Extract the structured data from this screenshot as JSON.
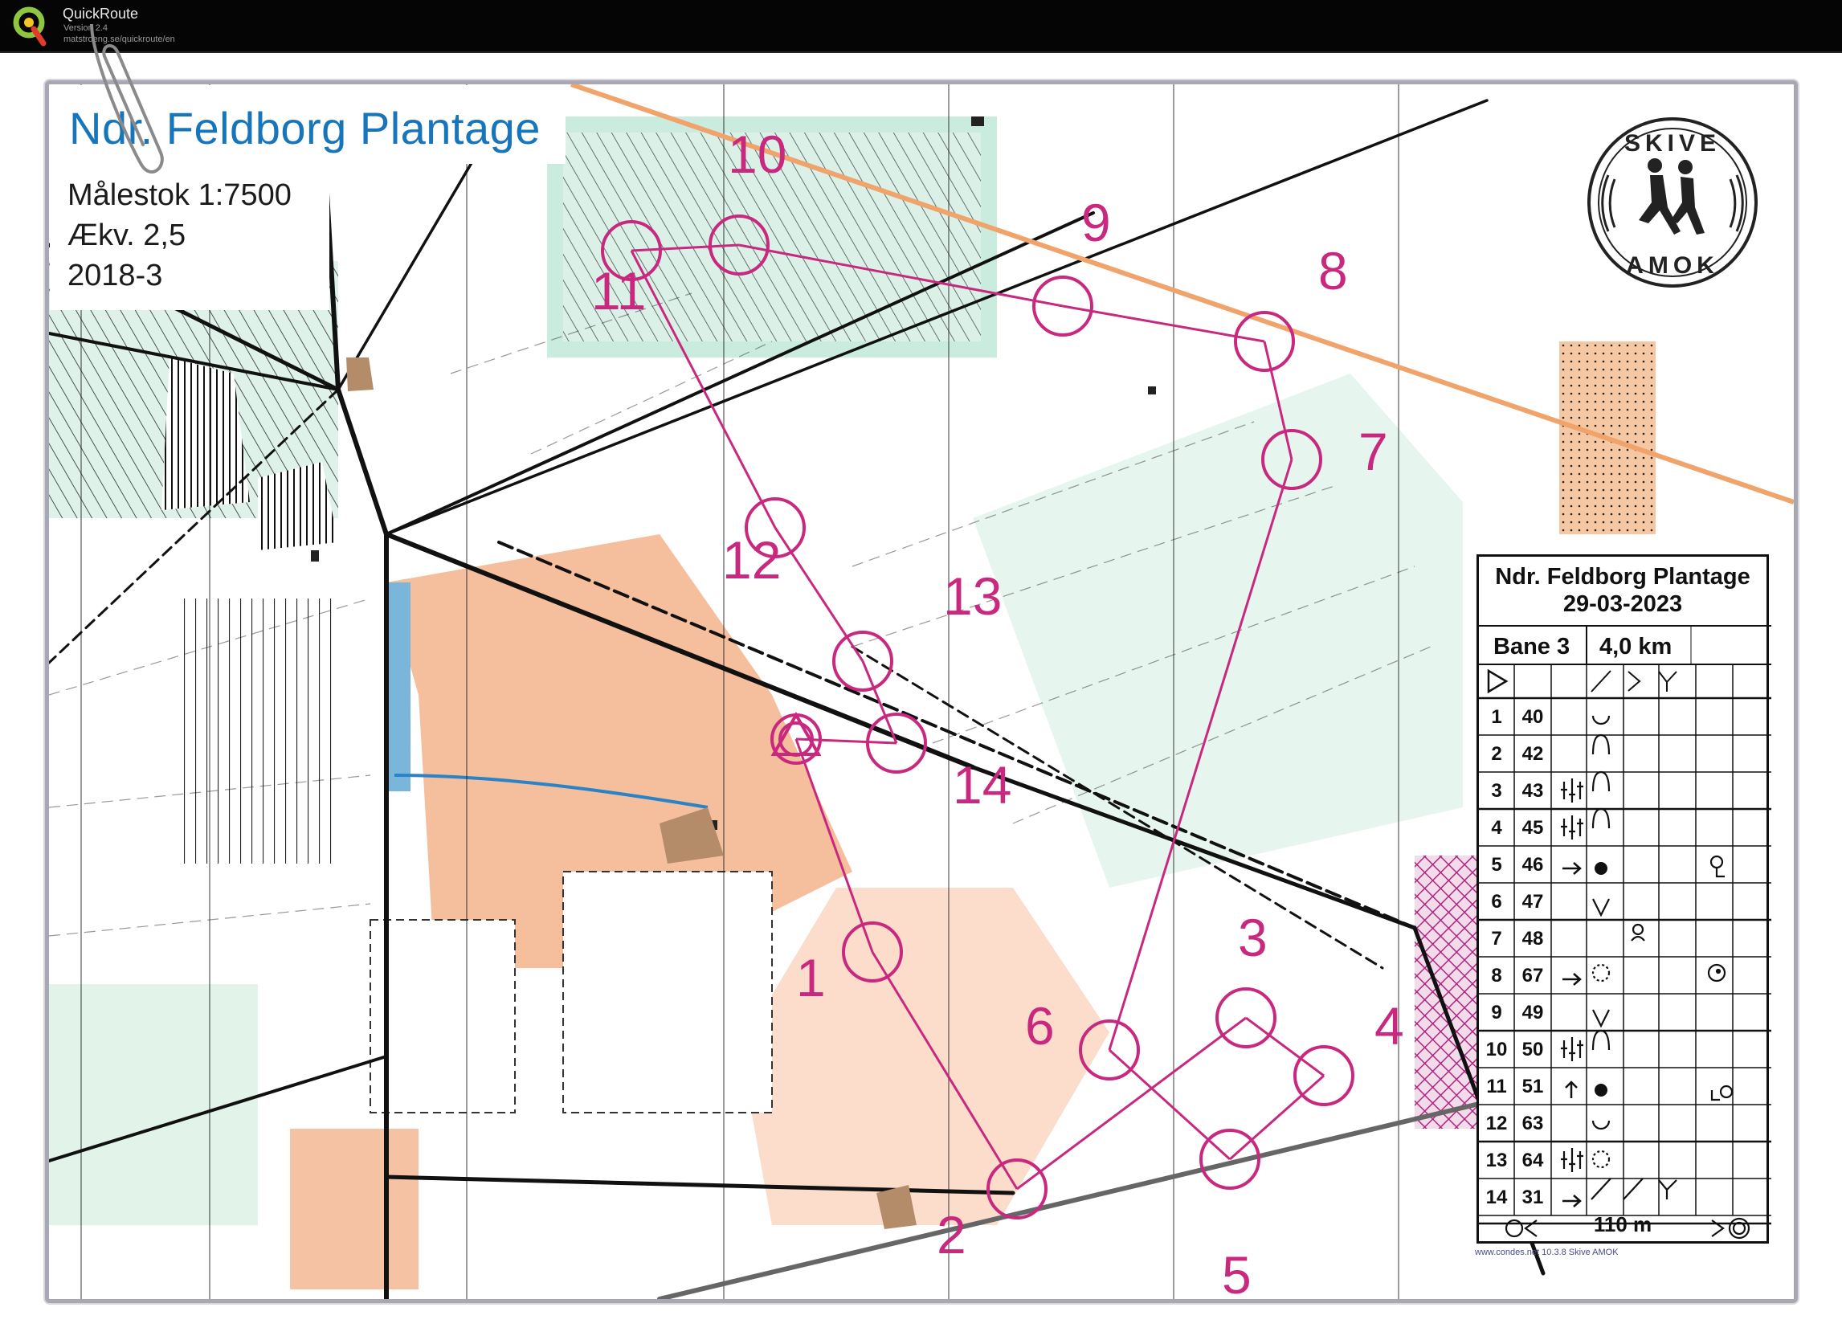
{
  "app": {
    "name": "QuickRoute",
    "version": "Version 2.4",
    "url": "matstroeng.se/quickroute/en"
  },
  "map": {
    "title": "Ndr. Feldborg Plantage",
    "scale": "Målestok 1:7500",
    "contour": "Ækv. 2,5",
    "edition": "2018-3",
    "club_logo_top": "SKIVE",
    "club_logo_bottom": "AMOK",
    "course_color": "#c8287e",
    "controls": [
      {
        "label": "1"
      },
      {
        "label": "2"
      },
      {
        "label": "3"
      },
      {
        "label": "4"
      },
      {
        "label": "5"
      },
      {
        "label": "6"
      },
      {
        "label": "7"
      },
      {
        "label": "8"
      },
      {
        "label": "9"
      },
      {
        "label": "10"
      },
      {
        "label": "11"
      },
      {
        "label": "12"
      },
      {
        "label": "13"
      },
      {
        "label": "14"
      }
    ],
    "credit": "www.condes.net 10.3.8 Skive AMOK"
  },
  "card": {
    "title_line1": "Ndr. Feldborg Plantage",
    "title_line2": "29-03-2023",
    "course": "Bane 3",
    "length": "4,0 km",
    "rows": [
      {
        "num": "1",
        "code": "40"
      },
      {
        "num": "2",
        "code": "42"
      },
      {
        "num": "3",
        "code": "43"
      },
      {
        "num": "4",
        "code": "45"
      },
      {
        "num": "5",
        "code": "46"
      },
      {
        "num": "6",
        "code": "47"
      },
      {
        "num": "7",
        "code": "48"
      },
      {
        "num": "8",
        "code": "67"
      },
      {
        "num": "9",
        "code": "49"
      },
      {
        "num": "10",
        "code": "50"
      },
      {
        "num": "11",
        "code": "51"
      },
      {
        "num": "12",
        "code": "63"
      },
      {
        "num": "13",
        "code": "64"
      },
      {
        "num": "14",
        "code": "31"
      }
    ],
    "finish": "110 m"
  }
}
